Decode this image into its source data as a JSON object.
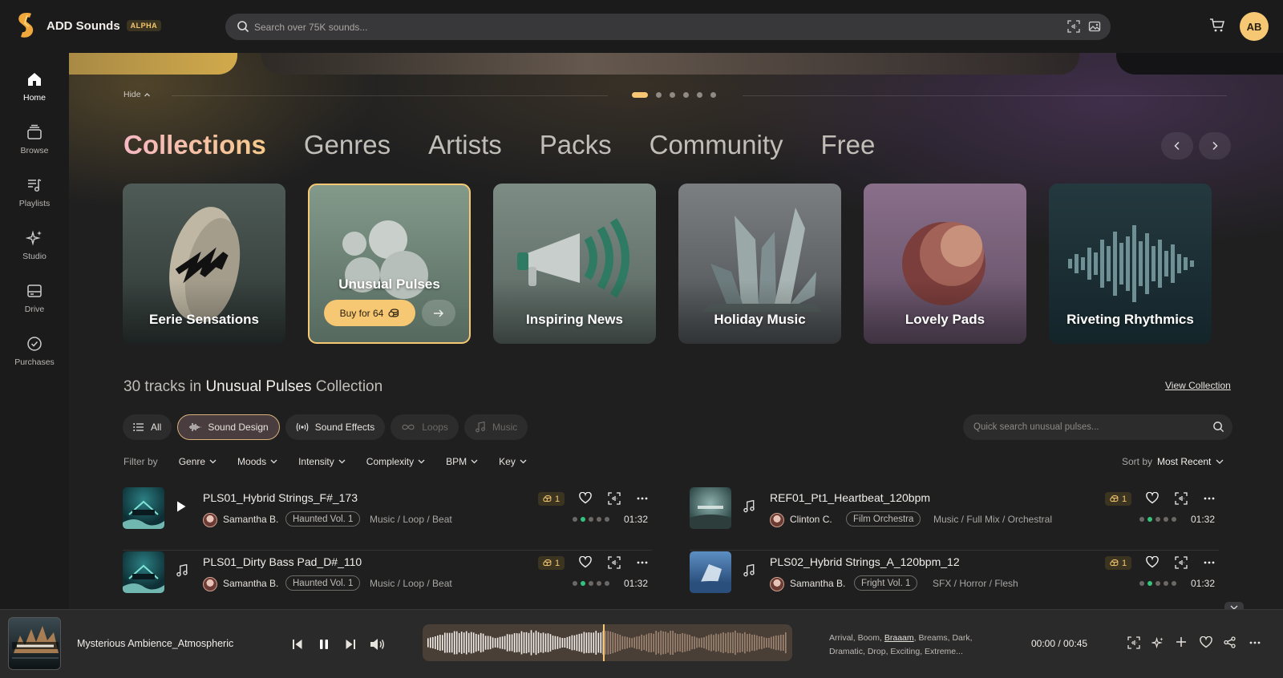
{
  "brand": {
    "name": "ADD Sounds",
    "badge": "ALPHA"
  },
  "search": {
    "placeholder": "Search over 75K sounds..."
  },
  "user": {
    "initials": "AB"
  },
  "sidebar": {
    "items": [
      {
        "label": "Home",
        "icon": "home-icon",
        "active": true
      },
      {
        "label": "Browse",
        "icon": "browse-icon"
      },
      {
        "label": "Playlists",
        "icon": "playlist-icon"
      },
      {
        "label": "Studio",
        "icon": "sparkle-icon"
      },
      {
        "label": "Drive",
        "icon": "drive-icon"
      },
      {
        "label": "Purchases",
        "icon": "check-circle-icon"
      }
    ]
  },
  "hero": {
    "hide_label": "Hide",
    "carousel_count": 6,
    "carousel_active": 0
  },
  "category_tabs": [
    "Collections",
    "Genres",
    "Artists",
    "Packs",
    "Community",
    "Free"
  ],
  "cards": [
    {
      "title": "Eerie Sensations"
    },
    {
      "title": "Unusual Pulses",
      "buy_label": "Buy for 64",
      "selected": true
    },
    {
      "title": "Inspiring News"
    },
    {
      "title": "Holiday Music"
    },
    {
      "title": "Lovely Pads"
    },
    {
      "title": "Riveting Rhythmics"
    }
  ],
  "tracks_heading": {
    "prefix": "30 tracks in",
    "collection": "Unusual Pulses",
    "suffix": "Collection"
  },
  "view_collection": "View Collection",
  "type_tabs": [
    {
      "label": "All",
      "icon": "list-icon"
    },
    {
      "label": "Sound Design",
      "icon": "waveform-icon",
      "active": true
    },
    {
      "label": "Sound Effects",
      "icon": "broadcast-icon"
    },
    {
      "label": "Loops",
      "icon": "infinity-icon",
      "disabled": true
    },
    {
      "label": "Music",
      "icon": "music-note-icon",
      "disabled": true
    }
  ],
  "quick_search": {
    "placeholder": "Quick search unusual pulses..."
  },
  "filters": {
    "label": "Filter by",
    "items": [
      "Genre",
      "Moods",
      "Intensity",
      "Complexity",
      "BPM",
      "Key"
    ]
  },
  "sort": {
    "label": "Sort by",
    "value": "Most Recent"
  },
  "tracks": [
    {
      "name": "PLS01_Hybrid Strings_F#_173",
      "artist": "Samantha B.",
      "album": "Haunted Vol. 1",
      "tags": "Music / Loop / Beat",
      "price": "1",
      "duration": "01:32",
      "level": 2,
      "playing": true
    },
    {
      "name": "REF01_Pt1_Heartbeat_120bpm",
      "artist": "Clinton C.",
      "album": "Film Orchestra",
      "tags": "Music / Full Mix / Orchestral",
      "price": "1",
      "duration": "01:32",
      "level": 2
    },
    {
      "name": "PLS01_Dirty Bass Pad_D#_110",
      "artist": "Samantha B.",
      "album": "Haunted Vol. 1",
      "tags": "Music / Loop / Beat",
      "price": "1",
      "duration": "01:32",
      "level": 2
    },
    {
      "name": "PLS02_Hybrid Strings_A_120bpm_12",
      "artist": "Samantha B.",
      "album": "Fright Vol. 1",
      "tags": "SFX / Horror / Flesh",
      "price": "1",
      "duration": "01:32",
      "level": 2
    }
  ],
  "player": {
    "title": "Mysterious Ambience_Atmospheric",
    "tags_line1": [
      "Arrival, Boom, ",
      "Braaam",
      ", Breams, Dark,"
    ],
    "tags_line2": "Dramatic, Drop, Exciting, Extreme...",
    "time": "00:00 / 00:45",
    "progress": 0.49
  },
  "colors": {
    "accent": "#f7c873",
    "green": "#35c27d",
    "bg": "#1e1e1f"
  }
}
